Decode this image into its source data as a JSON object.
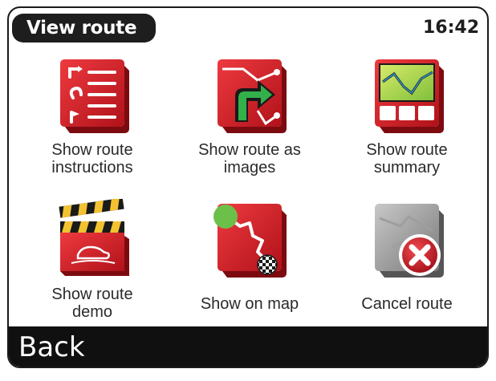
{
  "header": {
    "title": "View route",
    "clock": "16:42"
  },
  "menu": {
    "items": [
      {
        "id": "show-route-instructions",
        "lines": [
          "Show route",
          "instructions"
        ]
      },
      {
        "id": "show-route-as-images",
        "lines": [
          "Show route as",
          "images"
        ]
      },
      {
        "id": "show-route-summary",
        "lines": [
          "Show route",
          "summary"
        ]
      },
      {
        "id": "show-route-demo",
        "lines": [
          "Show route",
          "demo"
        ]
      },
      {
        "id": "show-on-map",
        "lines": [
          "Show on map"
        ]
      },
      {
        "id": "cancel-route",
        "lines": [
          "Cancel route"
        ]
      }
    ]
  },
  "footer": {
    "back_label": "Back"
  },
  "colors": {
    "accent_red": "#d91c24",
    "dark_red": "#8e0d12",
    "bar_black": "#101010"
  }
}
